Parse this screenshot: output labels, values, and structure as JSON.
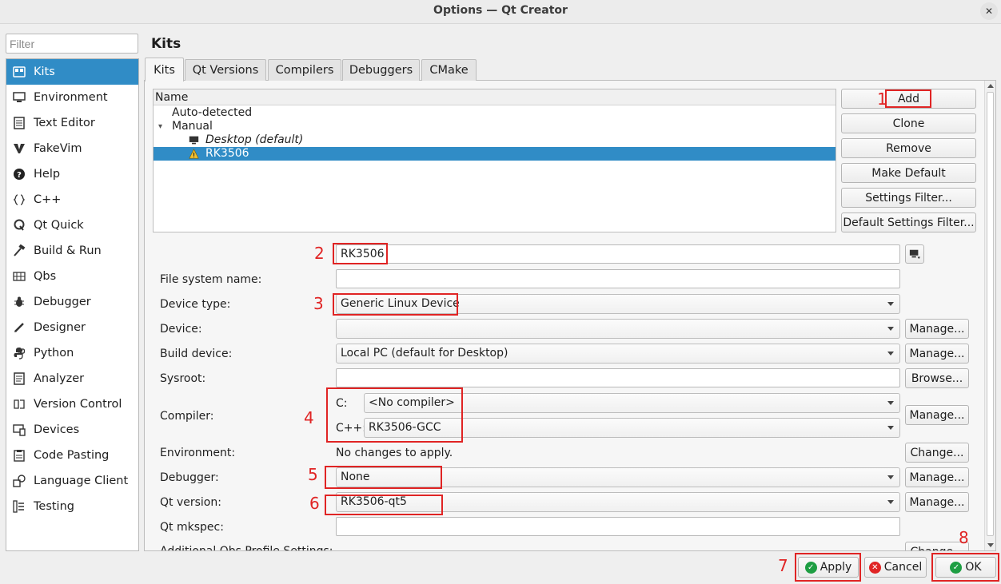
{
  "window": {
    "title": "Options — Qt Creator",
    "close_glyph": "✕"
  },
  "filter": {
    "placeholder": "Filter"
  },
  "sidebar": {
    "items": [
      {
        "label": "Kits",
        "icon": "kits-icon",
        "selected": true
      },
      {
        "label": "Environment",
        "icon": "monitor-icon"
      },
      {
        "label": "Text Editor",
        "icon": "text-editor-icon"
      },
      {
        "label": "FakeVim",
        "icon": "fakevim-icon"
      },
      {
        "label": "Help",
        "icon": "help-icon"
      },
      {
        "label": "C++",
        "icon": "braces-icon"
      },
      {
        "label": "Qt Quick",
        "icon": "qt-quick-icon"
      },
      {
        "label": "Build & Run",
        "icon": "hammer-icon"
      },
      {
        "label": "Qbs",
        "icon": "qbs-icon"
      },
      {
        "label": "Debugger",
        "icon": "bug-icon"
      },
      {
        "label": "Designer",
        "icon": "pen-icon"
      },
      {
        "label": "Python",
        "icon": "python-icon"
      },
      {
        "label": "Analyzer",
        "icon": "analyzer-icon"
      },
      {
        "label": "Version Control",
        "icon": "version-control-icon"
      },
      {
        "label": "Devices",
        "icon": "devices-icon"
      },
      {
        "label": "Code Pasting",
        "icon": "clipboard-icon"
      },
      {
        "label": "Language Client",
        "icon": "language-client-icon"
      },
      {
        "label": "Testing",
        "icon": "testing-icon"
      }
    ]
  },
  "page": {
    "title": "Kits"
  },
  "tabs": [
    {
      "label": "Kits",
      "active": true
    },
    {
      "label": "Qt Versions"
    },
    {
      "label": "Compilers"
    },
    {
      "label": "Debuggers"
    },
    {
      "label": "CMake"
    }
  ],
  "kits_tree": {
    "header": "Name",
    "rows": [
      {
        "label": "Auto-detected"
      },
      {
        "label": "Manual",
        "expander": "▾"
      },
      {
        "label": "Desktop (default)",
        "icon": "desktop-icon"
      },
      {
        "label": "RK3506",
        "icon": "warning-icon",
        "selected": true
      }
    ]
  },
  "kit_buttons": {
    "add": "Add",
    "clone": "Clone",
    "remove": "Remove",
    "make_default": "Make Default",
    "settings_filter": "Settings Filter...",
    "default_settings_filter": "Default Settings Filter..."
  },
  "form": {
    "name_value": "RK3506",
    "file_system_name": {
      "label": "File system name:",
      "value": ""
    },
    "device_type": {
      "label": "Device type:",
      "value": "Generic Linux Device"
    },
    "device": {
      "label": "Device:",
      "value": "",
      "button": "Manage..."
    },
    "build_device": {
      "label": "Build device:",
      "value": "Local PC (default for Desktop)",
      "button": "Manage..."
    },
    "sysroot": {
      "label": "Sysroot:",
      "value": "",
      "button": "Browse..."
    },
    "compiler": {
      "label": "Compiler:",
      "c_label": "C:",
      "c_value": "<No compiler>",
      "cpp_label": "C++:",
      "cpp_value": "RK3506-GCC",
      "button": "Manage..."
    },
    "environment": {
      "label": "Environment:",
      "value": "No changes to apply.",
      "button": "Change..."
    },
    "debugger": {
      "label": "Debugger:",
      "value": "None",
      "button": "Manage..."
    },
    "qt_version": {
      "label": "Qt version:",
      "value": "RK3506-qt5",
      "button": "Manage..."
    },
    "qt_mkspec": {
      "label": "Qt mkspec:",
      "value": ""
    },
    "qbs_profile": {
      "label": "Additional Qbs Profile Settings:",
      "button": "Change..."
    }
  },
  "annotations": [
    "1",
    "2",
    "3",
    "4",
    "5",
    "6",
    "7",
    "8"
  ],
  "footer": {
    "apply": "Apply",
    "cancel": "Cancel",
    "ok": "OK"
  },
  "colors": {
    "selection": "#308cc6",
    "annotation_red": "#e02424",
    "ok_green": "#1e9e43"
  }
}
